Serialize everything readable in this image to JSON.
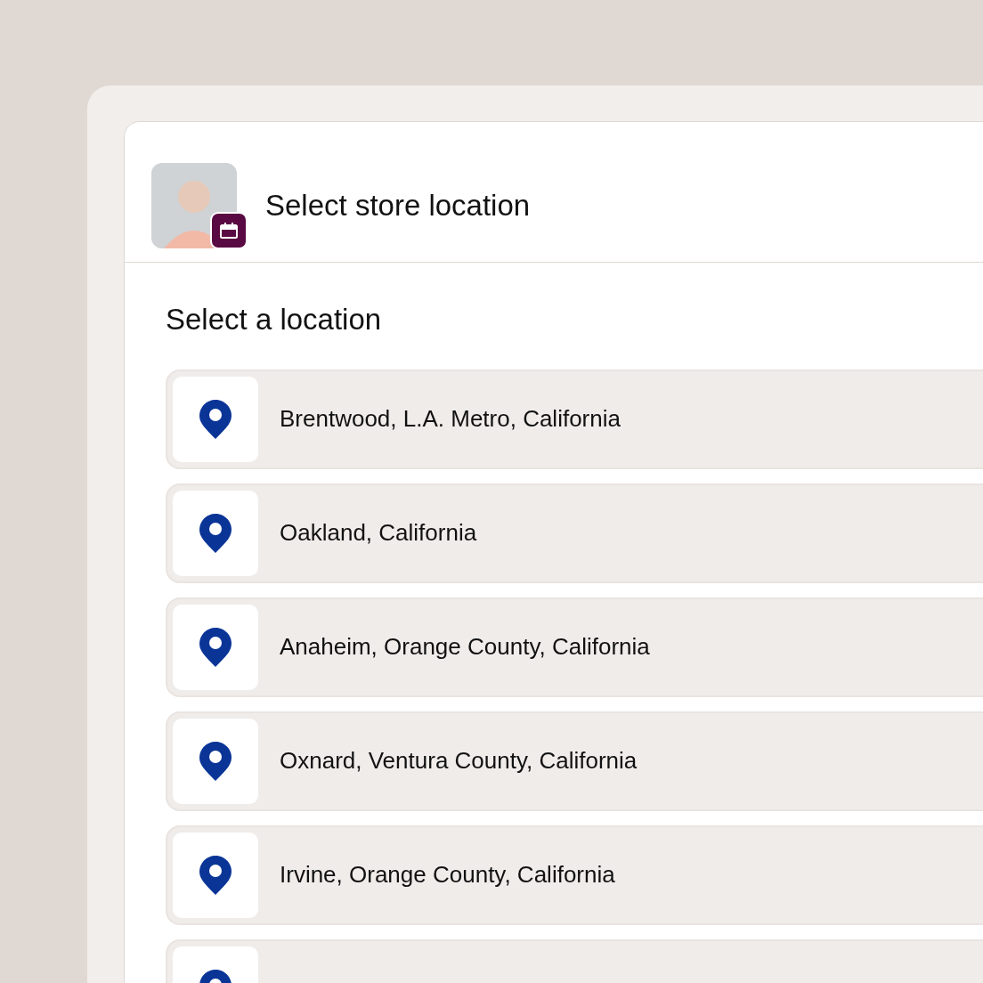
{
  "header": {
    "title": "Select store location"
  },
  "section": {
    "title": "Select a location"
  },
  "locations": [
    {
      "kind": "full",
      "label": "Brentwood, L.A. Metro, California"
    },
    {
      "kind": "full",
      "label": "Oakland, California"
    },
    {
      "kind": "full",
      "label": "Anaheim, Orange County, California"
    },
    {
      "kind": "full",
      "label": "Oxnard, Ventura County, California"
    },
    {
      "kind": "full",
      "label": "Irvine, Orange County, California"
    },
    {
      "kind": "cut_off"
    }
  ]
}
